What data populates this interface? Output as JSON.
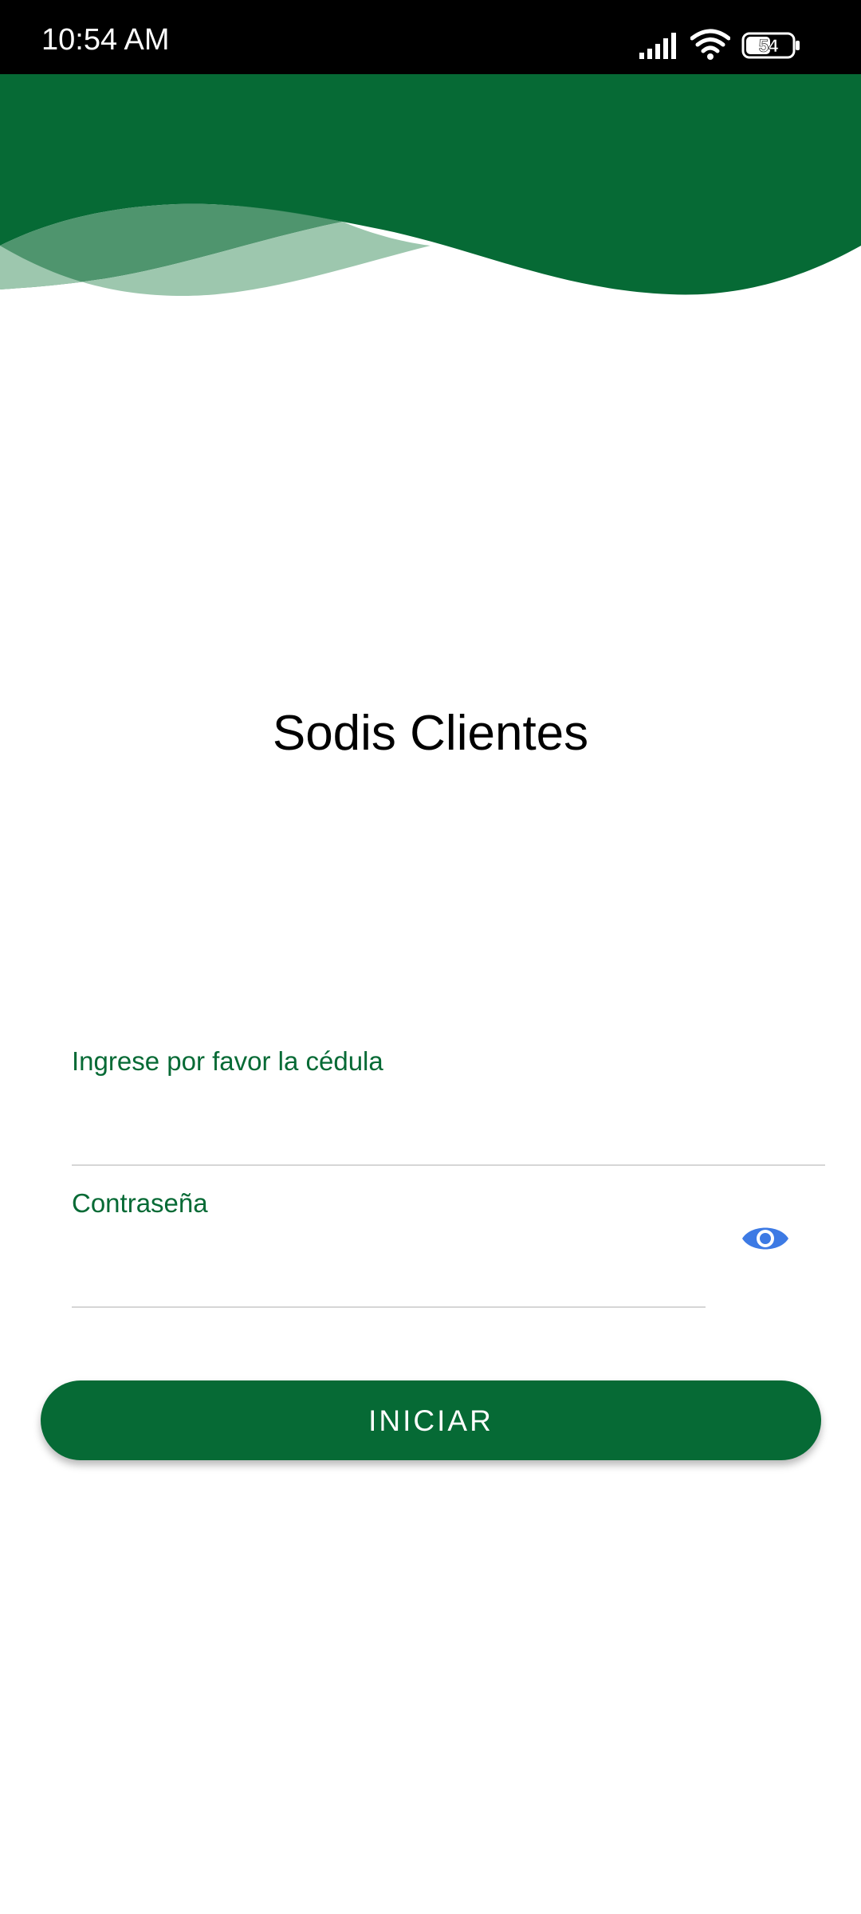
{
  "status_bar": {
    "time": "10:54 AM",
    "battery_level": "54",
    "icons": [
      "signal-icon",
      "wifi-icon",
      "battery-icon"
    ]
  },
  "app": {
    "title": "Sodis Clientes"
  },
  "form": {
    "cedula": {
      "label": "Ingrese por favor la cédula",
      "value": ""
    },
    "password": {
      "label": "Contraseña",
      "value": ""
    },
    "visibility_icon": "eye-icon",
    "submit_label": "INICIAR"
  },
  "colors": {
    "brand_green": "#066a35",
    "wave_light": "#9dc7ae",
    "wave_mid": "#3c8a5e",
    "eye_icon_blue": "#3d7ae4",
    "status_bar_bg": "#000000",
    "underline": "#d6d6d6"
  }
}
